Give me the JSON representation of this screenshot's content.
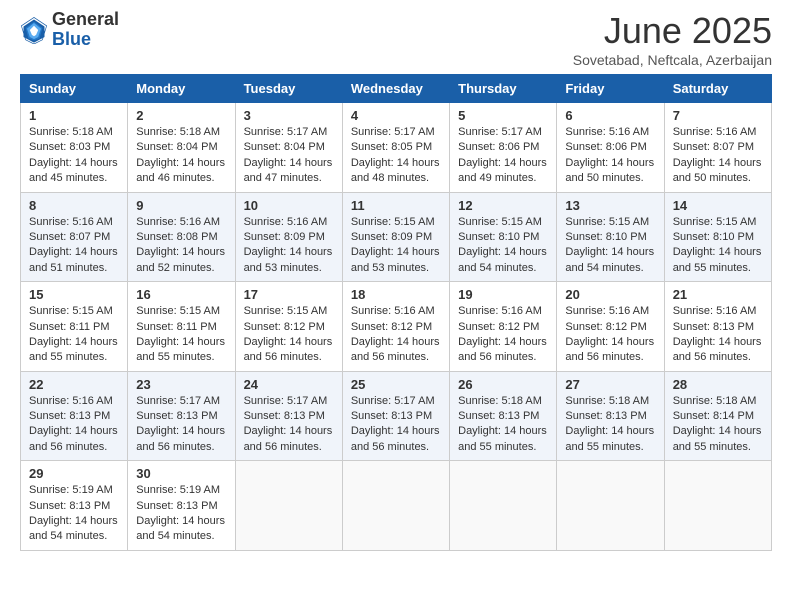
{
  "logo": {
    "general": "General",
    "blue": "Blue"
  },
  "title": {
    "month": "June 2025",
    "location": "Sovetabad, Neftcala, Azerbaijan"
  },
  "weekdays": [
    "Sunday",
    "Monday",
    "Tuesday",
    "Wednesday",
    "Thursday",
    "Friday",
    "Saturday"
  ],
  "weeks": [
    [
      {
        "day": "1",
        "sunrise": "5:18 AM",
        "sunset": "8:03 PM",
        "daylight": "14 hours and 45 minutes."
      },
      {
        "day": "2",
        "sunrise": "5:18 AM",
        "sunset": "8:04 PM",
        "daylight": "14 hours and 46 minutes."
      },
      {
        "day": "3",
        "sunrise": "5:17 AM",
        "sunset": "8:04 PM",
        "daylight": "14 hours and 47 minutes."
      },
      {
        "day": "4",
        "sunrise": "5:17 AM",
        "sunset": "8:05 PM",
        "daylight": "14 hours and 48 minutes."
      },
      {
        "day": "5",
        "sunrise": "5:17 AM",
        "sunset": "8:06 PM",
        "daylight": "14 hours and 49 minutes."
      },
      {
        "day": "6",
        "sunrise": "5:16 AM",
        "sunset": "8:06 PM",
        "daylight": "14 hours and 50 minutes."
      },
      {
        "day": "7",
        "sunrise": "5:16 AM",
        "sunset": "8:07 PM",
        "daylight": "14 hours and 50 minutes."
      }
    ],
    [
      {
        "day": "8",
        "sunrise": "5:16 AM",
        "sunset": "8:07 PM",
        "daylight": "14 hours and 51 minutes."
      },
      {
        "day": "9",
        "sunrise": "5:16 AM",
        "sunset": "8:08 PM",
        "daylight": "14 hours and 52 minutes."
      },
      {
        "day": "10",
        "sunrise": "5:16 AM",
        "sunset": "8:09 PM",
        "daylight": "14 hours and 53 minutes."
      },
      {
        "day": "11",
        "sunrise": "5:15 AM",
        "sunset": "8:09 PM",
        "daylight": "14 hours and 53 minutes."
      },
      {
        "day": "12",
        "sunrise": "5:15 AM",
        "sunset": "8:10 PM",
        "daylight": "14 hours and 54 minutes."
      },
      {
        "day": "13",
        "sunrise": "5:15 AM",
        "sunset": "8:10 PM",
        "daylight": "14 hours and 54 minutes."
      },
      {
        "day": "14",
        "sunrise": "5:15 AM",
        "sunset": "8:10 PM",
        "daylight": "14 hours and 55 minutes."
      }
    ],
    [
      {
        "day": "15",
        "sunrise": "5:15 AM",
        "sunset": "8:11 PM",
        "daylight": "14 hours and 55 minutes."
      },
      {
        "day": "16",
        "sunrise": "5:15 AM",
        "sunset": "8:11 PM",
        "daylight": "14 hours and 55 minutes."
      },
      {
        "day": "17",
        "sunrise": "5:15 AM",
        "sunset": "8:12 PM",
        "daylight": "14 hours and 56 minutes."
      },
      {
        "day": "18",
        "sunrise": "5:16 AM",
        "sunset": "8:12 PM",
        "daylight": "14 hours and 56 minutes."
      },
      {
        "day": "19",
        "sunrise": "5:16 AM",
        "sunset": "8:12 PM",
        "daylight": "14 hours and 56 minutes."
      },
      {
        "day": "20",
        "sunrise": "5:16 AM",
        "sunset": "8:12 PM",
        "daylight": "14 hours and 56 minutes."
      },
      {
        "day": "21",
        "sunrise": "5:16 AM",
        "sunset": "8:13 PM",
        "daylight": "14 hours and 56 minutes."
      }
    ],
    [
      {
        "day": "22",
        "sunrise": "5:16 AM",
        "sunset": "8:13 PM",
        "daylight": "14 hours and 56 minutes."
      },
      {
        "day": "23",
        "sunrise": "5:17 AM",
        "sunset": "8:13 PM",
        "daylight": "14 hours and 56 minutes."
      },
      {
        "day": "24",
        "sunrise": "5:17 AM",
        "sunset": "8:13 PM",
        "daylight": "14 hours and 56 minutes."
      },
      {
        "day": "25",
        "sunrise": "5:17 AM",
        "sunset": "8:13 PM",
        "daylight": "14 hours and 56 minutes."
      },
      {
        "day": "26",
        "sunrise": "5:18 AM",
        "sunset": "8:13 PM",
        "daylight": "14 hours and 55 minutes."
      },
      {
        "day": "27",
        "sunrise": "5:18 AM",
        "sunset": "8:13 PM",
        "daylight": "14 hours and 55 minutes."
      },
      {
        "day": "28",
        "sunrise": "5:18 AM",
        "sunset": "8:14 PM",
        "daylight": "14 hours and 55 minutes."
      }
    ],
    [
      {
        "day": "29",
        "sunrise": "5:19 AM",
        "sunset": "8:13 PM",
        "daylight": "14 hours and 54 minutes."
      },
      {
        "day": "30",
        "sunrise": "5:19 AM",
        "sunset": "8:13 PM",
        "daylight": "14 hours and 54 minutes."
      },
      null,
      null,
      null,
      null,
      null
    ]
  ]
}
